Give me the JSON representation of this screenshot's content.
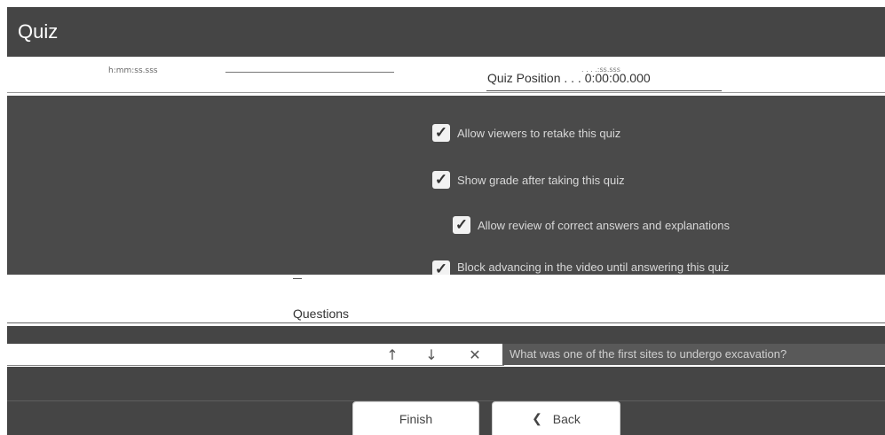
{
  "header": {
    "title": "Quiz"
  },
  "timeline": {
    "time_format": "h:mm:ss.sss",
    "time_readout": ". . . .:ss.sss",
    "quiz_position_label": "Quiz Position . . . 0:00:00.000"
  },
  "options": [
    {
      "label": "Allow viewers to retake this quiz",
      "checked": true
    },
    {
      "label": "Show grade after taking this quiz",
      "checked": true
    },
    {
      "label": "Allow review of correct answers and explanations",
      "checked": true
    },
    {
      "label": "Block advancing in the video until answering this quiz",
      "checked": true
    }
  ],
  "questions": {
    "section_label": "Questions",
    "items": [
      {
        "text": "What was one of the first sites to undergo excavation?"
      }
    ]
  },
  "icons": {
    "check": "check-icon",
    "up": "arrow-up-icon",
    "down": "arrow-down-icon",
    "delete": "close-icon",
    "back": "chevron-left-icon"
  },
  "footer": {
    "finish_label": "Finish",
    "back_label": "Back"
  },
  "colors": {
    "titlebar": "#454545",
    "panel": "#4a4a4a",
    "question_field": "#595959"
  }
}
